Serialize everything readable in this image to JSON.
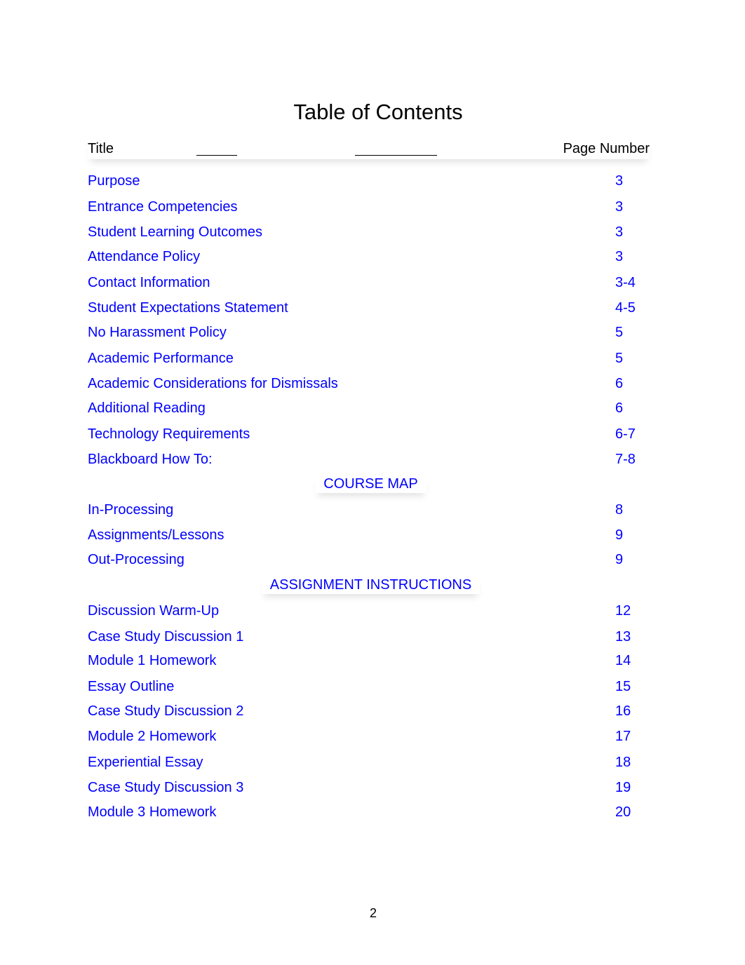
{
  "document": {
    "title": "Table of Contents",
    "header": {
      "title_col": "Title",
      "page_col": "Page Number"
    },
    "groups": [
      {
        "section": null,
        "entries": [
          {
            "title": "Purpose",
            "page": "3"
          },
          {
            "title": "Entrance Competencies",
            "page": "3"
          },
          {
            "title": "Student Learning Outcomes",
            "page": "3"
          },
          {
            "title": "Attendance Policy",
            "page": "3"
          },
          {
            "title": "Contact Information",
            "page": "3-4"
          },
          {
            "title": "Student Expectations Statement",
            "page": "4-5"
          },
          {
            "title": "No Harassment Policy",
            "page": "5"
          },
          {
            "title": "Academic Performance",
            "page": "5"
          },
          {
            "title": "Academic Considerations for Dismissals",
            "page": "6"
          },
          {
            "title": "Additional Reading",
            "page": "6"
          },
          {
            "title": "Technology Requirements",
            "page": "6-7"
          },
          {
            "title": "Blackboard How To:",
            "page": "7-8"
          }
        ]
      },
      {
        "section": "COURSE MAP",
        "entries": [
          {
            "title": "In-Processing",
            "page": "8"
          },
          {
            "title": "Assignments/Lessons",
            "page": "9"
          },
          {
            "title": "Out-Processing",
            "page": "9"
          }
        ]
      },
      {
        "section": "ASSIGNMENT INSTRUCTIONS",
        "entries": [
          {
            "title": "Discussion Warm-Up",
            "page": "12"
          },
          {
            "title": "Case Study Discussion 1",
            "page": "13"
          },
          {
            "title": "Module 1 Homework",
            "page": "14"
          },
          {
            "title": "Essay Outline",
            "page": "15"
          },
          {
            "title": "Case Study Discussion 2",
            "page": "16"
          },
          {
            "title": "Module 2 Homework",
            "page": "17"
          },
          {
            "title": "Experiential Essay",
            "page": "18"
          },
          {
            "title": "Case Study Discussion 3",
            "page": "19"
          },
          {
            "title": "Module 3 Homework",
            "page": "20"
          }
        ]
      }
    ],
    "page_number": "2",
    "link_color": "#0000ff"
  }
}
